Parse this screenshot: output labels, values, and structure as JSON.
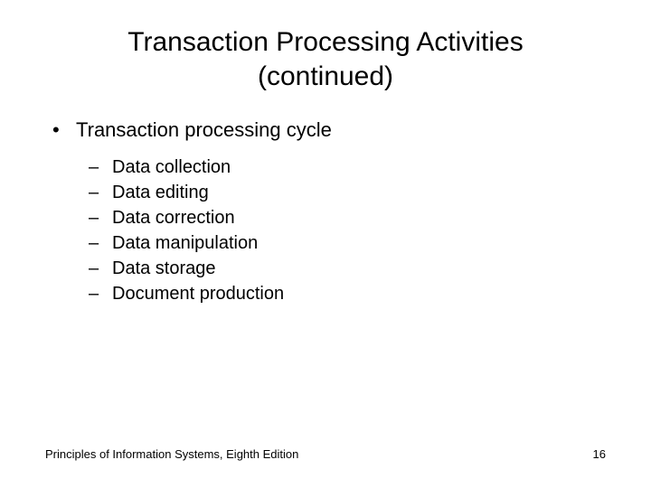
{
  "title_line1": "Transaction Processing Activities",
  "title_line2": "(continued)",
  "level1_text": "Transaction processing cycle",
  "sub_items": [
    "Data collection",
    "Data editing",
    "Data correction",
    "Data manipulation",
    "Data storage",
    "Document production"
  ],
  "footer_left": "Principles of Information Systems, Eighth Edition",
  "footer_right": "16"
}
